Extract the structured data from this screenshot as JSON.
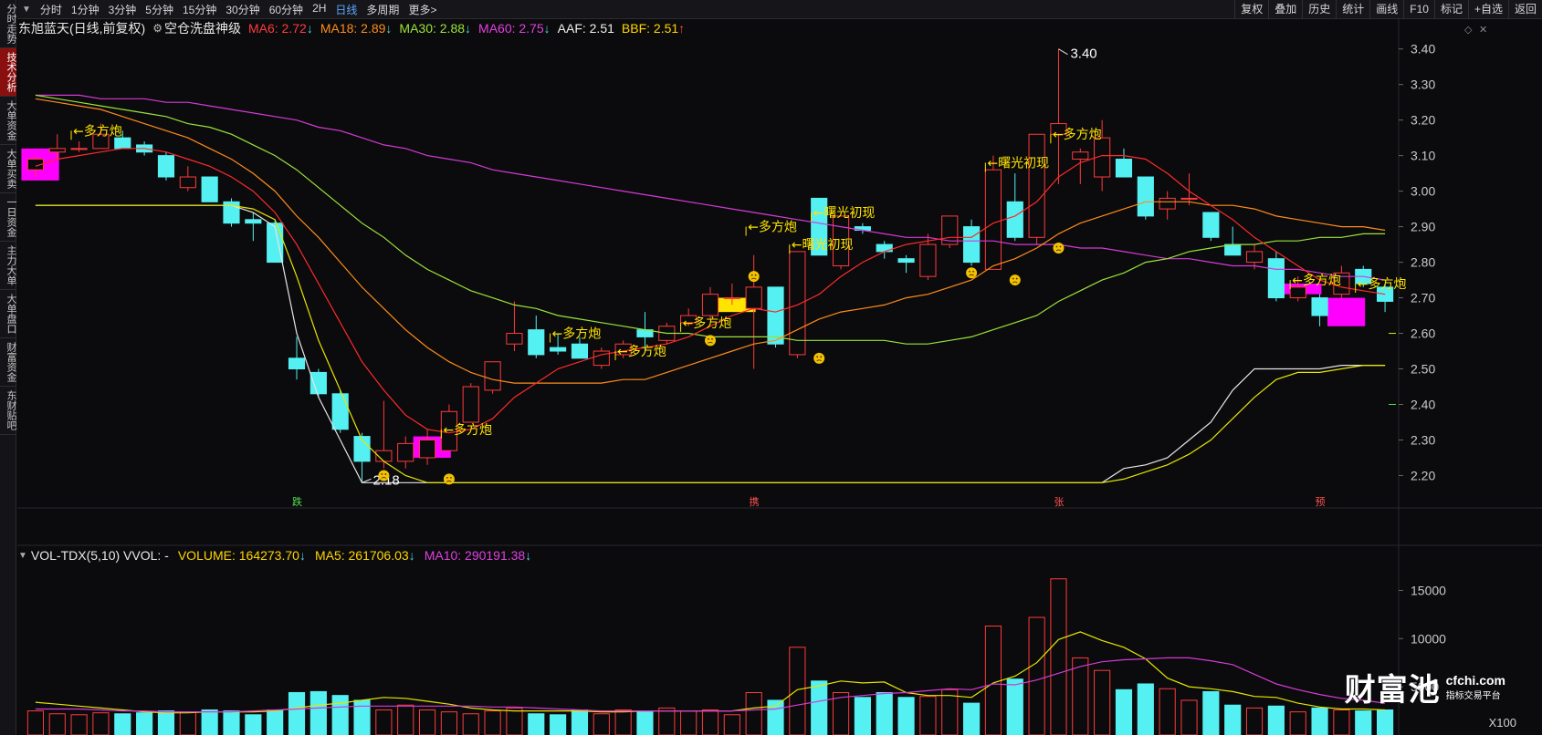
{
  "sidebar": {
    "items": [
      {
        "label": "分时走势",
        "active": false
      },
      {
        "label": "技术分析",
        "active": true
      },
      {
        "label": "大单资金",
        "active": false
      },
      {
        "label": "大单买卖",
        "active": false
      },
      {
        "label": "一日资金",
        "active": false
      },
      {
        "label": "主力大单",
        "active": false
      },
      {
        "label": "大单盘口",
        "active": false
      },
      {
        "label": "财富资金",
        "active": false
      },
      {
        "label": "东财贴吧",
        "active": false
      }
    ]
  },
  "toolbar": {
    "collapse_icon": "chevron-down-icon",
    "periods": [
      "分时",
      "1分钟",
      "3分钟",
      "5分钟",
      "15分钟",
      "30分钟",
      "60分钟",
      "2H",
      "日线",
      "多周期",
      "更多>"
    ],
    "active_period": "日线",
    "right_tools": [
      "复权",
      "叠加",
      "历史",
      "统计",
      "画线",
      "F10",
      "标记",
      "+自选",
      "返回"
    ]
  },
  "info": {
    "stock": "东旭蓝天(日线,前复权)",
    "indicator": "空仓洗盘神级",
    "ma6": "MA6: 2.72",
    "ma18": "MA18: 2.89",
    "ma30": "MA30: 2.88",
    "ma60": "MA60: 2.75",
    "aaf": "AAF: 2.51",
    "bbf": "BBF: 2.51",
    "ma6_arrow": "↓",
    "ma18_arrow": "↓",
    "ma30_arrow": "↓",
    "ma60_arrow": "↓",
    "bbf_arrow": "↑"
  },
  "volume_info": {
    "name": "VOL-TDX(5,10) VVOL: -",
    "volume": "VOLUME: 164273.70",
    "ma5": "MA5: 261706.03",
    "ma10": "MA10: 290191.38",
    "arrow": "↓"
  },
  "colors": {
    "up": "#ff3b3b",
    "down": "#54f0f2",
    "ma6": "#ff2a2a",
    "ma18": "#ff8c1a",
    "ma30": "#9be33a",
    "ma60": "#d43bd4",
    "label": "#ffe400",
    "magenta": "#ff00ff"
  },
  "chart_data": {
    "type": "candlestick",
    "price_axis": {
      "ticks": [
        "3.40",
        "3.30",
        "3.20",
        "3.10",
        "3.00",
        "2.90",
        "2.80",
        "2.70",
        "2.60",
        "2.50",
        "2.40",
        "2.30",
        "2.20"
      ],
      "range": [
        2.155,
        3.43
      ]
    },
    "volume_axis": {
      "ticks": [
        "15000",
        "10000",
        "5000"
      ],
      "range": [
        0,
        17500
      ],
      "unit": "X100"
    },
    "high_label": "3.40",
    "low_label": "2.18",
    "candles": [
      [
        3.06,
        3.09,
        3.04,
        3.1
      ],
      [
        3.11,
        3.12,
        3.09,
        3.16
      ],
      [
        3.12,
        3.12,
        3.11,
        3.14
      ],
      [
        3.12,
        3.16,
        3.12,
        3.19
      ],
      [
        3.15,
        3.12,
        3.12,
        3.17
      ],
      [
        3.13,
        3.11,
        3.1,
        3.14
      ],
      [
        3.1,
        3.04,
        3.03,
        3.11
      ],
      [
        3.01,
        3.04,
        3.0,
        3.07
      ],
      [
        3.04,
        2.97,
        2.97,
        3.04
      ],
      [
        2.97,
        2.91,
        2.9,
        2.98
      ],
      [
        2.92,
        2.91,
        2.86,
        2.94
      ],
      [
        2.91,
        2.8,
        2.8,
        2.92
      ],
      [
        2.53,
        2.5,
        2.47,
        2.59
      ],
      [
        2.49,
        2.43,
        2.42,
        2.5
      ],
      [
        2.43,
        2.33,
        2.32,
        2.44
      ],
      [
        2.31,
        2.24,
        2.18,
        2.32
      ],
      [
        2.24,
        2.27,
        2.22,
        2.41
      ],
      [
        2.24,
        2.29,
        2.22,
        2.31
      ],
      [
        2.25,
        2.3,
        2.23,
        2.33
      ],
      [
        2.27,
        2.38,
        2.27,
        2.4
      ],
      [
        2.35,
        2.45,
        2.35,
        2.46
      ],
      [
        2.44,
        2.52,
        2.43,
        2.52
      ],
      [
        2.57,
        2.6,
        2.55,
        2.69
      ],
      [
        2.61,
        2.54,
        2.53,
        2.65
      ],
      [
        2.56,
        2.55,
        2.54,
        2.6
      ],
      [
        2.57,
        2.53,
        2.53,
        2.59
      ],
      [
        2.51,
        2.55,
        2.5,
        2.56
      ],
      [
        2.54,
        2.57,
        2.53,
        2.58
      ],
      [
        2.61,
        2.59,
        2.55,
        2.66
      ],
      [
        2.58,
        2.62,
        2.57,
        2.63
      ],
      [
        2.63,
        2.65,
        2.62,
        2.67
      ],
      [
        2.65,
        2.71,
        2.64,
        2.73
      ],
      [
        2.7,
        2.7,
        2.68,
        2.74
      ],
      [
        2.67,
        2.73,
        2.5,
        2.82
      ],
      [
        2.73,
        2.57,
        2.56,
        2.73
      ],
      [
        2.54,
        2.83,
        2.53,
        2.83
      ],
      [
        2.98,
        2.82,
        2.82,
        2.98
      ],
      [
        2.79,
        2.93,
        2.78,
        2.93
      ],
      [
        2.9,
        2.89,
        2.88,
        2.91
      ],
      [
        2.85,
        2.83,
        2.81,
        2.86
      ],
      [
        2.81,
        2.8,
        2.77,
        2.82
      ],
      [
        2.76,
        2.85,
        2.75,
        2.88
      ],
      [
        2.85,
        2.93,
        2.84,
        2.93
      ],
      [
        2.9,
        2.8,
        2.79,
        2.92
      ],
      [
        2.78,
        3.06,
        2.78,
        3.1
      ],
      [
        2.97,
        2.87,
        2.86,
        3.05
      ],
      [
        2.87,
        3.16,
        2.85,
        3.16
      ],
      [
        3.16,
        3.19,
        3.02,
        3.4
      ],
      [
        3.09,
        3.11,
        3.02,
        3.12
      ],
      [
        3.04,
        3.15,
        3.0,
        3.2
      ],
      [
        3.09,
        3.04,
        3.04,
        3.12
      ],
      [
        3.04,
        2.93,
        2.92,
        3.04
      ],
      [
        2.95,
        2.98,
        2.92,
        3.0
      ],
      [
        2.98,
        2.98,
        2.96,
        3.05
      ],
      [
        2.94,
        2.87,
        2.86,
        2.94
      ],
      [
        2.85,
        2.82,
        2.82,
        2.9
      ],
      [
        2.8,
        2.83,
        2.78,
        2.85
      ],
      [
        2.81,
        2.7,
        2.69,
        2.83
      ],
      [
        2.7,
        2.73,
        2.69,
        2.76
      ],
      [
        2.7,
        2.65,
        2.62,
        2.71
      ],
      [
        2.71,
        2.77,
        2.7,
        2.79
      ],
      [
        2.78,
        2.74,
        2.73,
        2.79
      ],
      [
        2.73,
        2.69,
        2.66,
        2.74
      ]
    ],
    "ma6": [
      3.07,
      3.09,
      3.1,
      3.11,
      3.12,
      3.12,
      3.11,
      3.09,
      3.07,
      3.04,
      3.0,
      2.94,
      2.85,
      2.74,
      2.63,
      2.52,
      2.44,
      2.37,
      2.33,
      2.32,
      2.33,
      2.36,
      2.42,
      2.46,
      2.5,
      2.52,
      2.54,
      2.55,
      2.56,
      2.57,
      2.59,
      2.62,
      2.65,
      2.67,
      2.66,
      2.68,
      2.71,
      2.76,
      2.8,
      2.83,
      2.85,
      2.86,
      2.87,
      2.87,
      2.91,
      2.93,
      2.97,
      3.04,
      3.08,
      3.1,
      3.1,
      3.09,
      3.05,
      3.0,
      2.96,
      2.92,
      2.87,
      2.83,
      2.79,
      2.75,
      2.73,
      2.72,
      2.71
    ],
    "ma18": [
      3.26,
      3.25,
      3.24,
      3.23,
      3.21,
      3.19,
      3.17,
      3.15,
      3.12,
      3.09,
      3.05,
      3.0,
      2.93,
      2.87,
      2.8,
      2.73,
      2.67,
      2.61,
      2.56,
      2.52,
      2.49,
      2.47,
      2.46,
      2.46,
      2.46,
      2.46,
      2.46,
      2.47,
      2.47,
      2.49,
      2.51,
      2.53,
      2.55,
      2.57,
      2.58,
      2.61,
      2.64,
      2.66,
      2.67,
      2.68,
      2.7,
      2.71,
      2.73,
      2.75,
      2.79,
      2.81,
      2.84,
      2.88,
      2.91,
      2.93,
      2.95,
      2.97,
      2.97,
      2.97,
      2.96,
      2.96,
      2.95,
      2.93,
      2.92,
      2.91,
      2.9,
      2.9,
      2.89
    ],
    "ma30": [
      3.27,
      3.26,
      3.25,
      3.24,
      3.23,
      3.22,
      3.21,
      3.19,
      3.18,
      3.16,
      3.13,
      3.1,
      3.06,
      3.01,
      2.96,
      2.91,
      2.87,
      2.82,
      2.78,
      2.75,
      2.72,
      2.7,
      2.68,
      2.67,
      2.65,
      2.64,
      2.63,
      2.62,
      2.61,
      2.6,
      2.6,
      2.59,
      2.59,
      2.59,
      2.59,
      2.58,
      2.58,
      2.58,
      2.58,
      2.58,
      2.57,
      2.57,
      2.58,
      2.59,
      2.61,
      2.63,
      2.65,
      2.69,
      2.72,
      2.75,
      2.77,
      2.8,
      2.81,
      2.83,
      2.84,
      2.85,
      2.85,
      2.86,
      2.86,
      2.87,
      2.87,
      2.88,
      2.88
    ],
    "ma60": [
      3.27,
      3.27,
      3.27,
      3.26,
      3.26,
      3.26,
      3.25,
      3.25,
      3.24,
      3.23,
      3.22,
      3.21,
      3.2,
      3.18,
      3.17,
      3.15,
      3.13,
      3.12,
      3.1,
      3.09,
      3.08,
      3.06,
      3.05,
      3.04,
      3.03,
      3.02,
      3.01,
      3.0,
      2.99,
      2.98,
      2.97,
      2.96,
      2.95,
      2.94,
      2.93,
      2.92,
      2.91,
      2.9,
      2.89,
      2.88,
      2.87,
      2.87,
      2.86,
      2.86,
      2.86,
      2.85,
      2.85,
      2.85,
      2.84,
      2.84,
      2.83,
      2.82,
      2.81,
      2.81,
      2.8,
      2.79,
      2.79,
      2.78,
      2.78,
      2.77,
      2.76,
      2.76,
      2.75
    ],
    "aaf": [
      2.96,
      2.96,
      2.96,
      2.96,
      2.96,
      2.96,
      2.96,
      2.96,
      2.96,
      2.96,
      2.94,
      2.9,
      2.6,
      2.42,
      2.3,
      2.18,
      2.18,
      2.18,
      2.18,
      2.18,
      2.18,
      2.18,
      2.18,
      2.18,
      2.18,
      2.18,
      2.18,
      2.18,
      2.18,
      2.18,
      2.18,
      2.18,
      2.18,
      2.18,
      2.18,
      2.18,
      2.18,
      2.18,
      2.18,
      2.18,
      2.18,
      2.18,
      2.18,
      2.18,
      2.18,
      2.18,
      2.18,
      2.18,
      2.18,
      2.18,
      2.22,
      2.23,
      2.25,
      2.3,
      2.35,
      2.44,
      2.5,
      2.5,
      2.5,
      2.5,
      2.51,
      2.51,
      2.51
    ],
    "bbf": [
      2.96,
      2.96,
      2.96,
      2.96,
      2.96,
      2.96,
      2.96,
      2.96,
      2.96,
      2.96,
      2.95,
      2.92,
      2.76,
      2.58,
      2.44,
      2.3,
      2.24,
      2.2,
      2.18,
      2.18,
      2.18,
      2.18,
      2.18,
      2.18,
      2.18,
      2.18,
      2.18,
      2.18,
      2.18,
      2.18,
      2.18,
      2.18,
      2.18,
      2.18,
      2.18,
      2.18,
      2.18,
      2.18,
      2.18,
      2.18,
      2.18,
      2.18,
      2.18,
      2.18,
      2.18,
      2.18,
      2.18,
      2.18,
      2.18,
      2.18,
      2.19,
      2.21,
      2.23,
      2.26,
      2.3,
      2.36,
      2.42,
      2.47,
      2.49,
      2.49,
      2.5,
      2.51,
      2.51
    ],
    "volume": [
      2500,
      2200,
      2100,
      2300,
      2200,
      2300,
      2500,
      2400,
      2600,
      2500,
      2100,
      2600,
      4400,
      4500,
      4100,
      3600,
      2600,
      3100,
      2600,
      2400,
      2200,
      2500,
      2800,
      2200,
      2100,
      2600,
      2200,
      2600,
      2400,
      2800,
      2500,
      2600,
      2100,
      4400,
      3600,
      9100,
      5600,
      4400,
      3900,
      4400,
      3900,
      4000,
      4700,
      3300,
      11300,
      5800,
      12200,
      16200,
      8000,
      6700,
      4700,
      5300,
      4800,
      3600,
      4500,
      3100,
      2800,
      3000,
      2400,
      2800,
      2600,
      2500,
      2600
    ],
    "vol_ma5": [
      3400,
      3200,
      3000,
      2800,
      2600,
      2400,
      2300,
      2300,
      2400,
      2400,
      2400,
      2500,
      2800,
      3100,
      3300,
      3600,
      3900,
      3800,
      3500,
      3200,
      2800,
      2600,
      2500,
      2500,
      2500,
      2500,
      2400,
      2400,
      2500,
      2500,
      2500,
      2500,
      2500,
      2800,
      3000,
      4700,
      5100,
      5600,
      5400,
      5500,
      4400,
      4100,
      4100,
      3900,
      5400,
      6100,
      7500,
      9900,
      10700,
      9800,
      9100,
      7900,
      5900,
      5000,
      4800,
      4500,
      4000,
      3900,
      3300,
      2900,
      2700,
      2700,
      2600
    ],
    "vol_ma10": [
      2700,
      2700,
      2700,
      2600,
      2500,
      2500,
      2400,
      2400,
      2400,
      2400,
      2500,
      2600,
      2700,
      2800,
      2900,
      3000,
      3000,
      3000,
      3000,
      3000,
      3000,
      2900,
      2900,
      2800,
      2700,
      2600,
      2500,
      2500,
      2500,
      2500,
      2500,
      2500,
      2500,
      2600,
      2700,
      3100,
      3500,
      3900,
      4100,
      4300,
      4400,
      4600,
      4800,
      4700,
      5300,
      5200,
      5700,
      6400,
      7100,
      7600,
      7800,
      7900,
      8000,
      8000,
      7700,
      7300,
      6300,
      5300,
      4700,
      4200,
      3800,
      3600,
      3300
    ],
    "signals": [
      {
        "index": 2,
        "text": "多方炮",
        "price": 3.17
      },
      {
        "index": 19,
        "text": "多方炮",
        "price": 2.33
      },
      {
        "index": 24,
        "text": "多方炮",
        "price": 2.6
      },
      {
        "index": 27,
        "text": "多方炮",
        "price": 2.55
      },
      {
        "index": 30,
        "text": "多方炮",
        "price": 2.63
      },
      {
        "index": 33,
        "text": "多方炮",
        "price": 2.9
      },
      {
        "index": 36,
        "text": "曙光初现",
        "price": 2.94
      },
      {
        "index": 35,
        "text": "曙光初现",
        "price": 2.85
      },
      {
        "index": 44,
        "text": "曙光初现",
        "price": 3.08
      },
      {
        "index": 47,
        "text": "多方炮",
        "price": 3.16
      },
      {
        "index": 58,
        "text": "多方炮",
        "price": 2.75
      },
      {
        "index": 61,
        "text": "多方炮",
        "price": 2.74
      }
    ],
    "date_markers": [
      {
        "index": 12,
        "text": "跌"
      },
      {
        "index": 33,
        "text": "携"
      },
      {
        "index": 47,
        "text": "张"
      },
      {
        "index": 59,
        "text": "预"
      }
    ],
    "magenta_boxes": [
      {
        "index": 0,
        "top": 3.12,
        "bottom": 3.03
      },
      {
        "index": 18,
        "top": 2.31,
        "bottom": 2.25
      },
      {
        "index": 58,
        "top": 2.74,
        "bottom": 2.71
      },
      {
        "index": 60,
        "top": 2.7,
        "bottom": 2.62
      }
    ],
    "yellow_boxes": [
      {
        "index": 32,
        "top": 2.7,
        "bottom": 2.66
      }
    ],
    "faces": [
      {
        "index": 16,
        "price": 2.2
      },
      {
        "index": 19,
        "price": 2.19
      },
      {
        "index": 31,
        "price": 2.58
      },
      {
        "index": 33,
        "price": 2.76
      },
      {
        "index": 36,
        "price": 2.53
      },
      {
        "index": 43,
        "price": 2.77
      },
      {
        "index": 45,
        "price": 2.75
      },
      {
        "index": 47,
        "price": 2.84
      }
    ]
  }
}
